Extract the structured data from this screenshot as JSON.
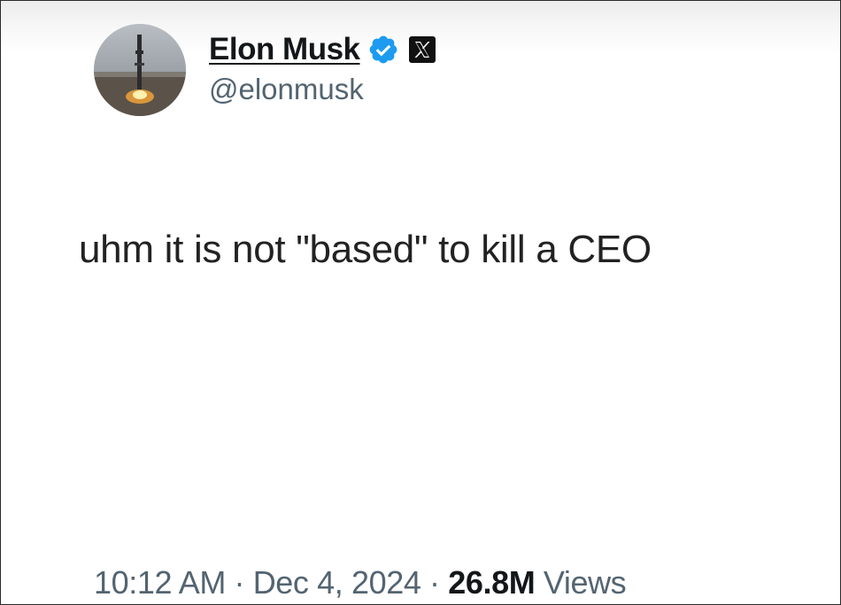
{
  "author": {
    "display_name": "Elon Musk",
    "handle": "@elonmusk",
    "verified_badge_color": "#1d9bf0",
    "avatar_icon": "rocket-launch-avatar",
    "platform_icon": "x-logo-icon"
  },
  "tweet": {
    "text": "uhm it is not \"based\" to kill a CEO"
  },
  "meta": {
    "time": "10:12 AM",
    "separator_1": " · ",
    "date": "Dec 4, 2024",
    "separator_2": " · ",
    "views_count": "26.8M",
    "views_label": "Views"
  }
}
